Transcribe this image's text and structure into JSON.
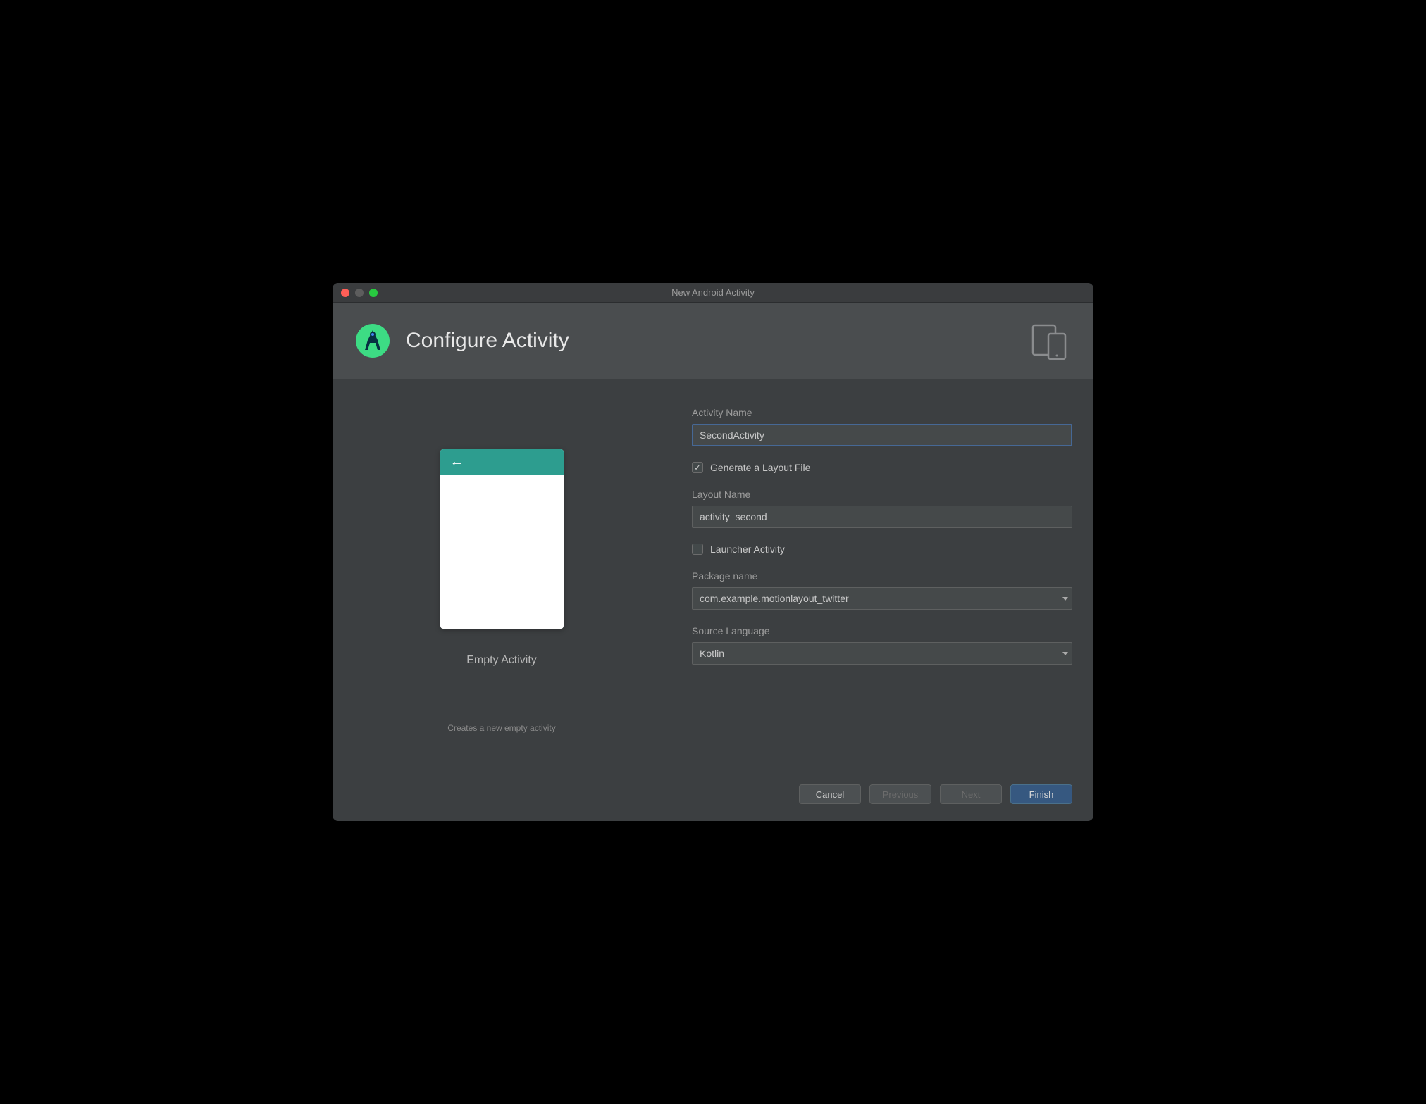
{
  "window": {
    "title": "New Android Activity"
  },
  "header": {
    "title": "Configure Activity"
  },
  "preview": {
    "label": "Empty Activity",
    "description": "Creates a new empty activity"
  },
  "form": {
    "activityName": {
      "label": "Activity Name",
      "value": "SecondActivity"
    },
    "generateLayout": {
      "label": "Generate a Layout File",
      "checked": true
    },
    "layoutName": {
      "label": "Layout Name",
      "value": "activity_second"
    },
    "launcherActivity": {
      "label": "Launcher Activity",
      "checked": false
    },
    "packageName": {
      "label": "Package name",
      "value": "com.example.motionlayout_twitter"
    },
    "sourceLanguage": {
      "label": "Source Language",
      "value": "Kotlin"
    }
  },
  "footer": {
    "cancel": "Cancel",
    "previous": "Previous",
    "next": "Next",
    "finish": "Finish"
  }
}
